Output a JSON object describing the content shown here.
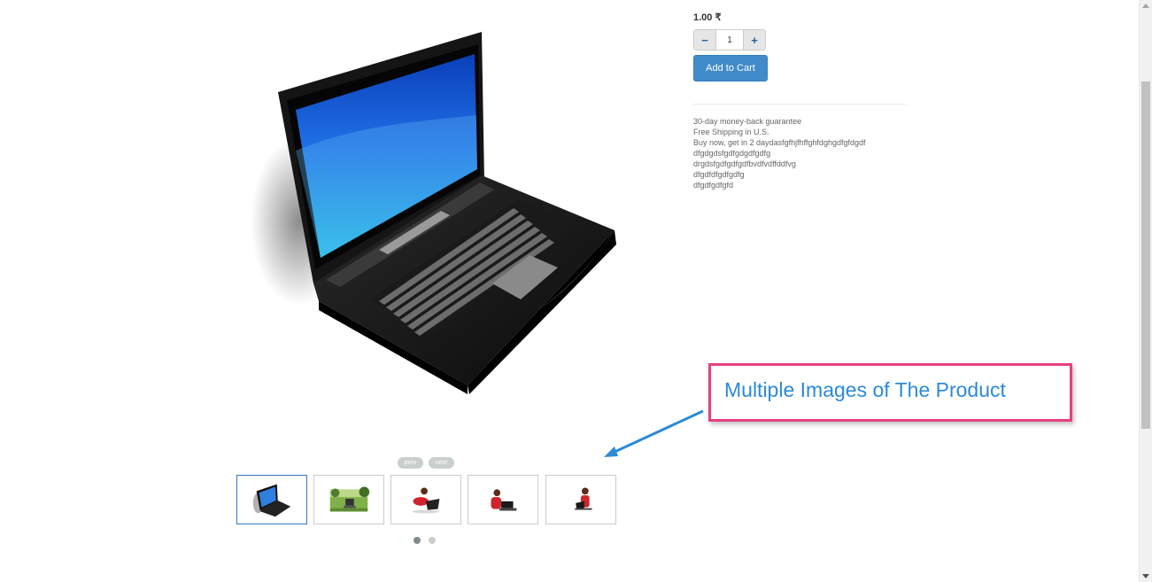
{
  "product": {
    "title_fragment": " ",
    "price": "1.00 ₹",
    "quantity": "1",
    "add_to_cart_label": "Add to Cart",
    "description_lines": [
      "30-day money-back guarantee",
      "Free Shipping in U.S.",
      "Buy now, get in 2 daydasfgfhjfhffghfdghgdfgfdgdf",
      "dfgdgdsfgdfgdgdfgdfg",
      "drgdsfgdfgdfgdfbvdfvdffddfvg",
      "dfgdfdfgdfgdfg",
      "dfgdfgdfgfd"
    ]
  },
  "carousel": {
    "prev_label": "prev",
    "next_label": "next",
    "thumbnails": [
      "laptop-thumbnail",
      "laptop-on-grass-thumbnail",
      "woman-with-laptop-thumbnail",
      "woman-lying-with-laptop-thumbnail",
      "woman-sitting-with-laptop-thumbnail"
    ],
    "active_thumbnail": 1,
    "active_page": 1,
    "page_count": 2
  },
  "annotation": {
    "text": "Multiple Images of The Product",
    "border_color": "#e8407f",
    "text_color": "#2c8ad8"
  },
  "colors": {
    "button_primary": "#428bca",
    "active_thumb_border": "#3c74c6"
  }
}
